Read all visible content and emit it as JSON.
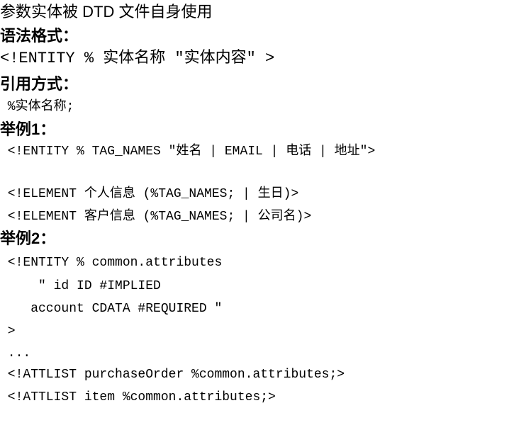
{
  "document": {
    "title": "参数实体被 DTD 文件自身使用",
    "syntax_heading": "语法格式：",
    "syntax_line": "<!ENTITY % 实体名称 \"实体内容\" >",
    "reference_heading": "引用方式：",
    "reference_line": " %实体名称;",
    "example1_heading": "举例1：",
    "example1_lines": [
      " <!ENTITY % TAG_NAMES \"姓名 | EMAIL | 电话 | 地址\">",
      " <!ELEMENT 个人信息 (%TAG_NAMES; | 生日)>",
      " <!ELEMENT 客户信息 (%TAG_NAMES; | 公司名)>"
    ],
    "example2_heading": "举例2：",
    "example2_lines": [
      " <!ENTITY % common.attributes",
      "     \" id ID #IMPLIED",
      "    account CDATA #REQUIRED \"",
      " >",
      " ...",
      " <!ATTLIST purchaseOrder %common.attributes;>",
      " <!ATTLIST item %common.attributes;>"
    ]
  }
}
